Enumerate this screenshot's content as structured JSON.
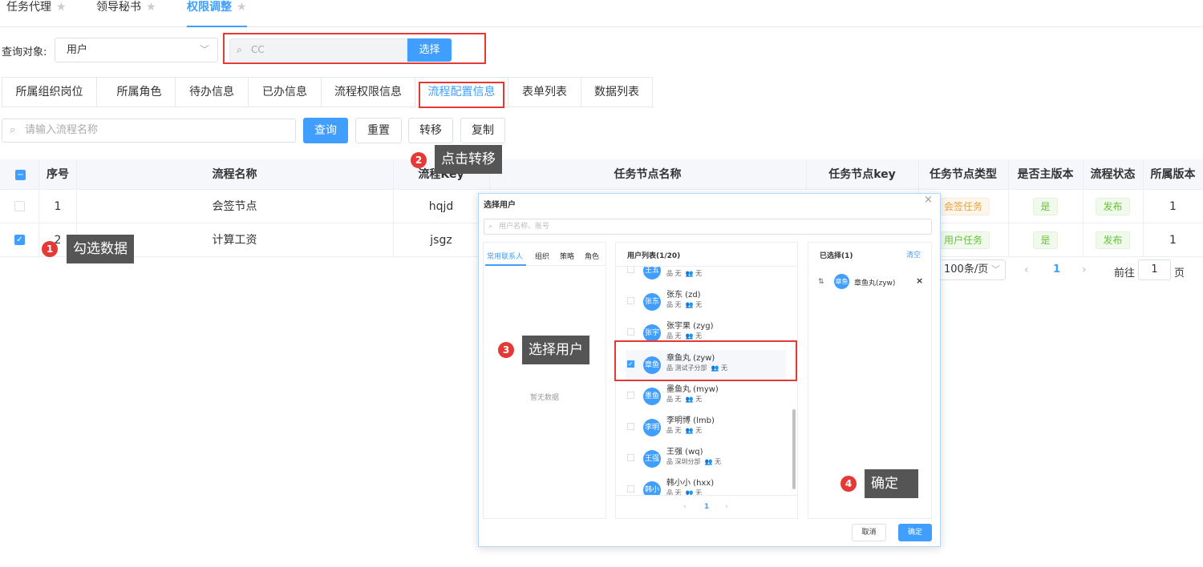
{
  "top_tabs": [
    {
      "label": "任务代理"
    },
    {
      "label": "领导秘书"
    },
    {
      "label": "权限调整"
    }
  ],
  "query": {
    "label": "查询对象:",
    "object_value": "用户",
    "search_value": "CC",
    "select_button": "选择"
  },
  "info_tabs": [
    "所属组织岗位",
    "所属角色",
    "待办信息",
    "已办信息",
    "流程权限信息",
    "流程配置信息",
    "表单列表",
    "数据列表"
  ],
  "filter": {
    "placeholder": "请输入流程名称",
    "query_button": "查询",
    "reset_button": "重置",
    "transfer_button": "转移",
    "copy_button": "复制"
  },
  "table": {
    "headers": [
      "序号",
      "流程名称",
      "流程Key",
      "任务节点名称",
      "任务节点key",
      "任务节点类型",
      "是否主版本",
      "流程状态",
      "所属版本"
    ],
    "rows": [
      {
        "index": "1",
        "name": "会签节点",
        "key": "hqjd",
        "node_type": "会签任务",
        "is_main": "是",
        "status": "发布",
        "version": "1"
      },
      {
        "index": "2",
        "name": "计算工资",
        "key": "jsgz",
        "node_type": "用户任务",
        "is_main": "是",
        "status": "发布",
        "version": "1"
      }
    ]
  },
  "pagination": {
    "page_size": "100条/页",
    "current": "1",
    "goto_label": "前往",
    "goto_value": "1",
    "page_suffix": "页"
  },
  "annotations": [
    {
      "num": "1",
      "text": "勾选数据"
    },
    {
      "num": "2",
      "text": "点击转移"
    },
    {
      "num": "3",
      "text": "选择用户"
    },
    {
      "num": "4",
      "text": "确定"
    }
  ],
  "dialog": {
    "title": "选择用户",
    "close": "×",
    "search_placeholder": "用户名称、账号",
    "left_tabs": [
      "常用联系人",
      "组织",
      "策略",
      "角色"
    ],
    "empty_text": "暂无数据",
    "list_title": "用户列表(1/20)",
    "users": [
      {
        "avatar": "王五",
        "name": "",
        "org": "无",
        "role": "无",
        "checked": false
      },
      {
        "avatar": "张东",
        "name": "张东  (zd)",
        "org": "无",
        "role": "无",
        "checked": false
      },
      {
        "avatar": "张宇",
        "name": "张宇果  (zyg)",
        "org": "无",
        "role": "无",
        "checked": false
      },
      {
        "avatar": "章鱼",
        "name": "章鱼丸  (zyw)",
        "org": "测试子分部",
        "role": "无",
        "checked": true
      },
      {
        "avatar": "墨鱼",
        "name": "墨鱼丸  (myw)",
        "org": "无",
        "role": "无",
        "checked": false
      },
      {
        "avatar": "李明",
        "name": "李明博  (lmb)",
        "org": "无",
        "role": "无",
        "checked": false
      },
      {
        "avatar": "王强",
        "name": "王强  (wq)",
        "org": "深圳分部",
        "role": "无",
        "checked": false
      },
      {
        "avatar": "韩小",
        "name": "韩小小  (hxx)",
        "org": "无",
        "role": "无",
        "checked": false
      }
    ],
    "list_page": "1",
    "selected_title": "已选择(1)",
    "clear": "清空",
    "selected": [
      {
        "avatar": "章鱼",
        "name": "章鱼丸(zyw)"
      }
    ],
    "cancel_button": "取消",
    "confirm_button": "确定"
  },
  "colors": {
    "primary": "#409eff",
    "annotation": "#e53935",
    "callout": "#555555"
  }
}
